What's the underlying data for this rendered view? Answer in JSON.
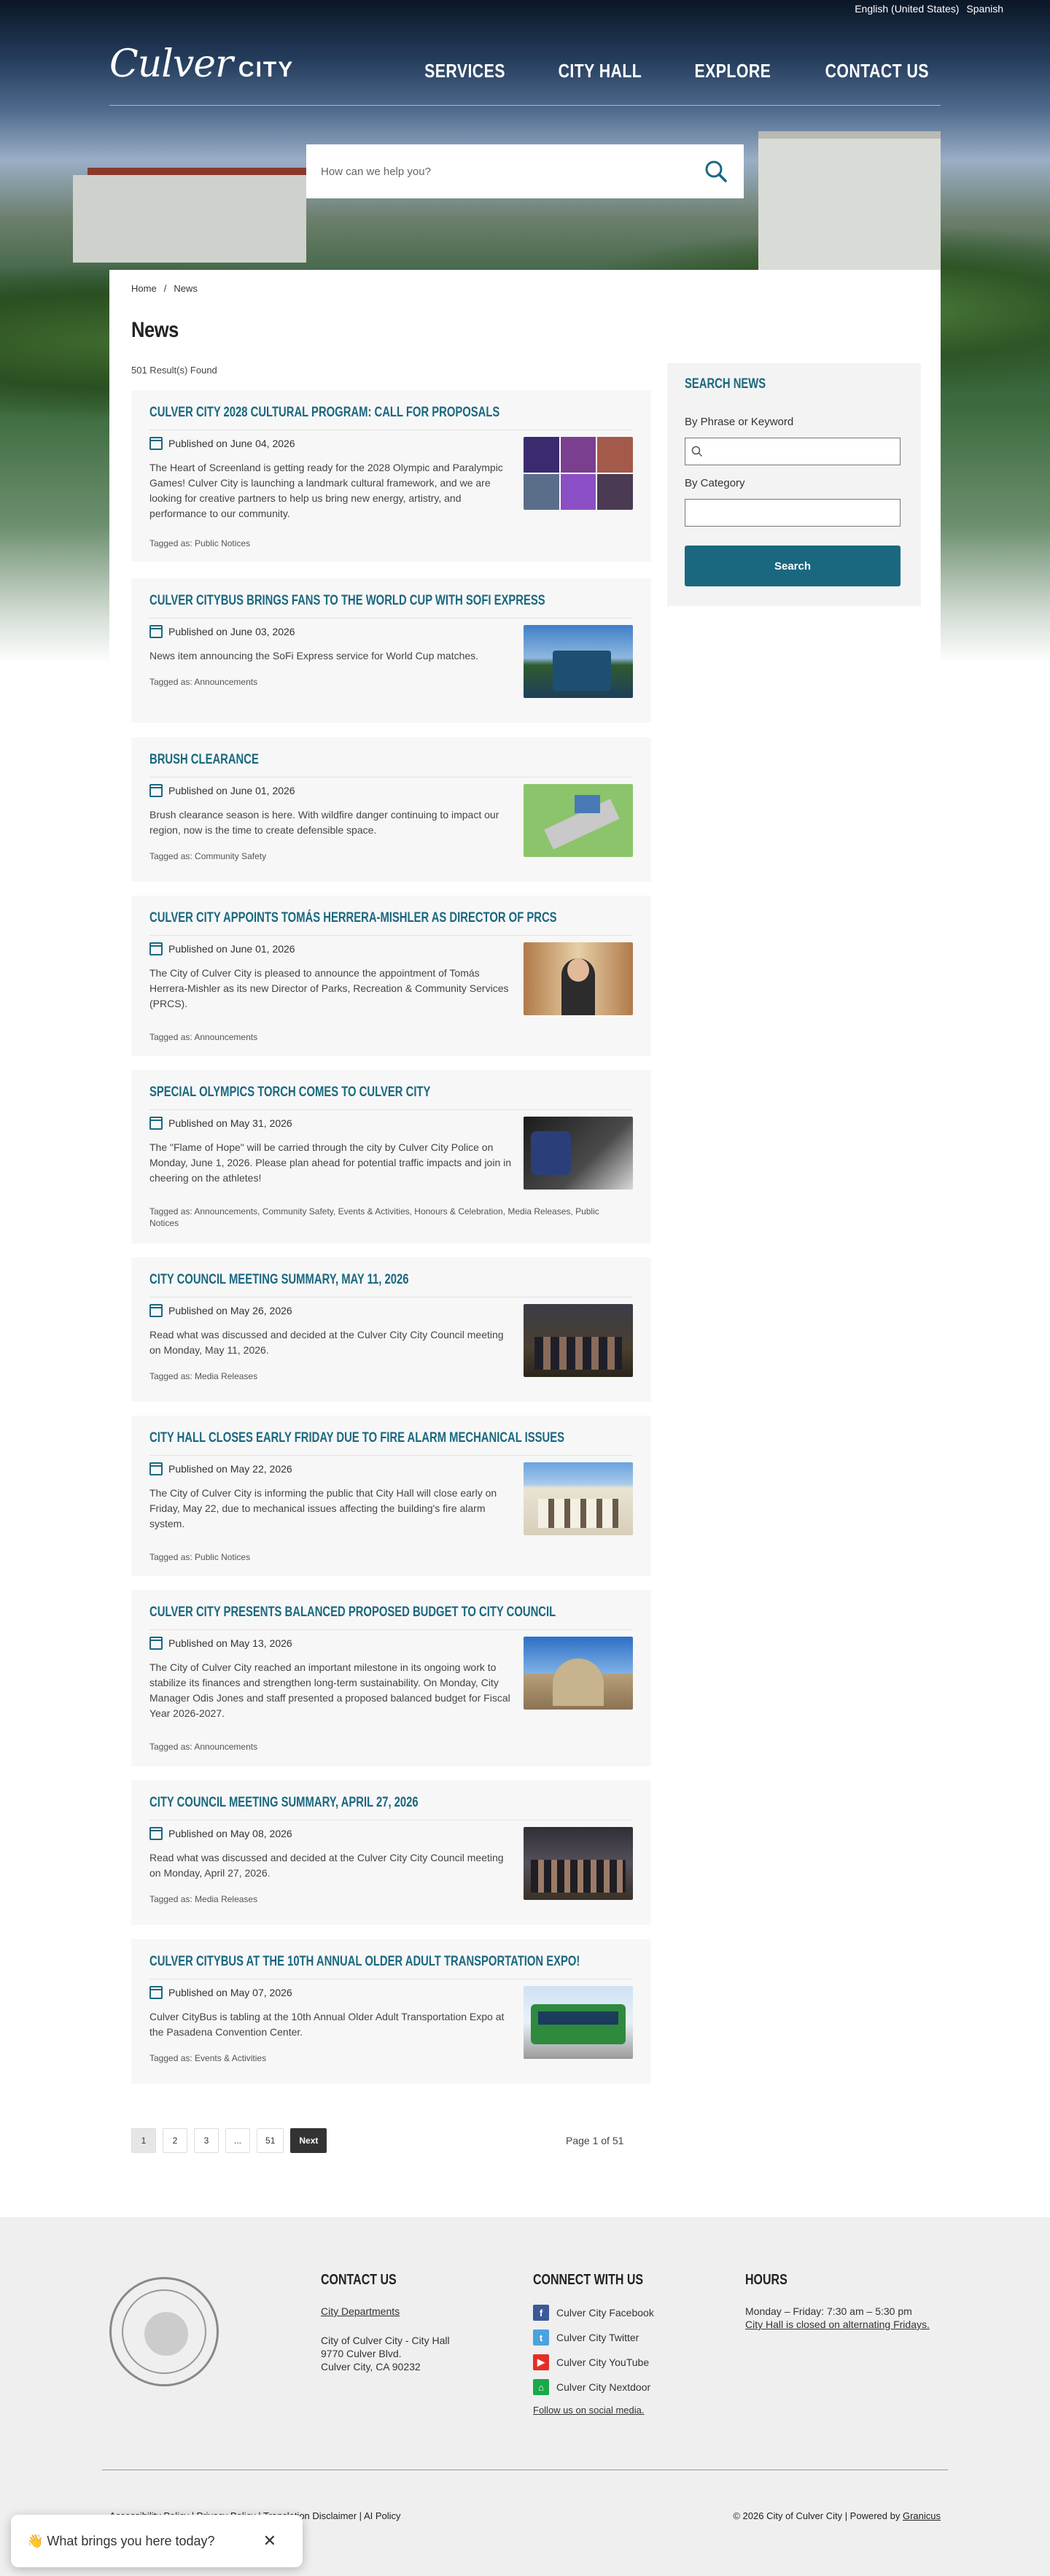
{
  "topbar": {
    "lang_en": "English (United States)",
    "lang_es": "Spanish"
  },
  "brand": {
    "logo_script": "Culver",
    "logo_city": "CITY"
  },
  "nav": {
    "items": [
      "SERVICES",
      "CITY HALL",
      "EXPLORE",
      "CONTACT US"
    ]
  },
  "hero_search": {
    "placeholder": "How can we help you?"
  },
  "breadcrumb": {
    "home": "Home",
    "sep": "/",
    "current": "News"
  },
  "page": {
    "title": "News",
    "results": "501 Result(s) Found"
  },
  "colors": {
    "accent": "#1a6880",
    "card_bg": "#f7f7f7",
    "footer_bg": "#efefef"
  },
  "news": [
    {
      "title": "CULVER CITY 2028 CULTURAL PROGRAM: CALL FOR PROPOSALS",
      "published": "Published on June 04, 2026",
      "body": "The Heart of Screenland is getting ready for the 2028 Olympic and Paralympic Games! Culver City is launching a landmark cultural framework, and we are looking for creative partners to help us bring new energy, artistry, and performance to our community.",
      "tags": "Tagged as: Public Notices"
    },
    {
      "title": "CULVER CITYBUS BRINGS FANS TO THE WORLD CUP WITH SOFI EXPRESS",
      "published": "Published on June 03, 2026",
      "body": "News item announcing the SoFi Express service for World Cup matches.",
      "tags": "Tagged as: Announcements"
    },
    {
      "title": "BRUSH CLEARANCE",
      "published": "Published on June 01, 2026",
      "body": "Brush clearance season is here. With wildfire danger continuing to impact our region, now is the time to create defensible space.",
      "tags": "Tagged as: Community Safety"
    },
    {
      "title": "CULVER CITY APPOINTS TOMÁS HERRERA-MISHLER AS DIRECTOR OF PRCS",
      "published": "Published on June 01, 2026",
      "body": "The City of Culver City is pleased to announce the appointment of Tomás Herrera-Mishler as its new Director of Parks, Recreation & Community Services (PRCS).",
      "tags": "Tagged as: Announcements"
    },
    {
      "title": "SPECIAL OLYMPICS TORCH COMES TO CULVER CITY",
      "published": "Published on May 31, 2026",
      "body": "The \"Flame of Hope\" will be carried through the city by Culver City Police on Monday, June 1, 2026. Please plan ahead for potential traffic impacts and join in cheering on the athletes!",
      "tags": "Tagged as: Announcements, Community Safety, Events & Activities, Honours & Celebration, Media Releases, Public Notices"
    },
    {
      "title": "CITY COUNCIL MEETING SUMMARY, MAY 11, 2026",
      "published": "Published on May 26, 2026",
      "body": "Read what was discussed and decided at the Culver City City Council meeting on Monday, May 11, 2026.",
      "tags": "Tagged as: Media Releases"
    },
    {
      "title": "CITY HALL CLOSES EARLY FRIDAY DUE TO FIRE ALARM MECHANICAL ISSUES",
      "published": "Published on May 22, 2026",
      "body": "The City of Culver City is informing the public that City Hall will close early on Friday, May 22, due to mechanical issues affecting the building's fire alarm system.",
      "tags": "Tagged as: Public Notices"
    },
    {
      "title": "CULVER CITY PRESENTS BALANCED PROPOSED BUDGET TO CITY COUNCIL",
      "published": "Published on May 13, 2026",
      "body": "The City of Culver City reached an important milestone in its ongoing work to stabilize its finances and strengthen long-term sustainability. On Monday, City Manager Odis Jones and staff presented a proposed balanced budget for Fiscal Year 2026-2027.",
      "tags": "Tagged as: Announcements"
    },
    {
      "title": "CITY COUNCIL MEETING SUMMARY, APRIL 27, 2026",
      "published": "Published on May 08, 2026",
      "body": "Read what was discussed and decided at the Culver City City Council meeting on Monday, April 27, 2026.",
      "tags": "Tagged as: Media Releases"
    },
    {
      "title": "CULVER CITYBUS AT THE 10TH ANNUAL OLDER ADULT TRANSPORTATION EXPO!",
      "published": "Published on May 07, 2026",
      "body": "Culver CityBus is tabling at the 10th Annual Older Adult Transportation Expo at the Pasadena Convention Center.",
      "tags": "Tagged as: Events & Activities"
    }
  ],
  "sidebar": {
    "title": "SEARCH NEWS",
    "phrase_label": "By Phrase or Keyword",
    "category_label": "By Category",
    "button": "Search"
  },
  "pagination": {
    "pages": [
      "1",
      "2",
      "3",
      "...",
      "51"
    ],
    "next": "Next",
    "status": "Page 1 of 51"
  },
  "footer": {
    "contact": {
      "title": "CONTACT US",
      "dept_link": "City Departments",
      "line1": "City of Culver City - City Hall",
      "line2": "9770 Culver Blvd.",
      "line3": "Culver City, CA 90232"
    },
    "connect": {
      "title": "CONNECT WITH US",
      "facebook": "Culver City Facebook",
      "twitter": "Culver City Twitter",
      "youtube": "Culver City YouTube",
      "nextdoor": "Culver City Nextdoor",
      "follow": "Follow us on social media."
    },
    "hours": {
      "title": "HOURS",
      "line1": "Monday – Friday: 7:30 am – 5:30 pm",
      "line2": "City Hall is closed on alternating Fridays."
    },
    "legal": "Accessibility Policy | Privacy Policy | Translation Disclaimer | AI Policy",
    "copyright": "© 2026 City of Culver City | Powered by",
    "granicus": "Granicus"
  },
  "chat": {
    "prompt": "👋 What brings you here today?",
    "close": "✕"
  }
}
